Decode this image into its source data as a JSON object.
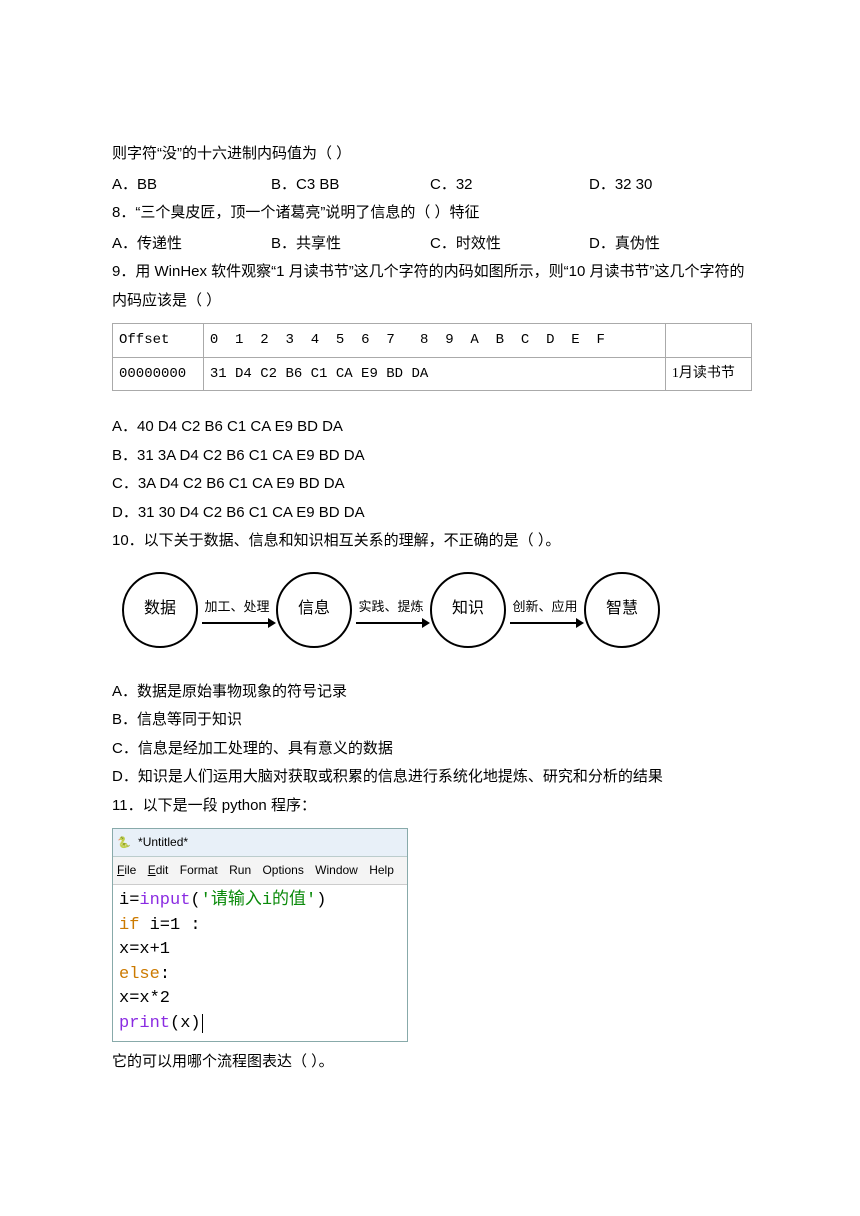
{
  "q7": {
    "stem": "则字符“没”的十六进制内码值为（    ）",
    "A": "A．BB",
    "B": "B．C3 BB",
    "C": "C．32",
    "D": "D．32 30"
  },
  "q8": {
    "stem": "8．“三个臭皮匠，顶一个诸葛亮”说明了信息的（    ）特征",
    "A": "A．传递性",
    "B": "B．共享性",
    "C": "C．时效性",
    "D": "D．真伪性"
  },
  "q9": {
    "stem": "9．用 WinHex 软件观察“1 月读书节”这几个字符的内码如图所示，则“10 月读书节”这几个字符的内码应该是（  ）",
    "table": {
      "headers": [
        "Offset",
        "0",
        "1",
        "2",
        "3",
        "4",
        "5",
        "6",
        "7",
        "",
        "8",
        "9",
        "A",
        "B",
        "C",
        "D",
        "E",
        "F",
        ""
      ],
      "row_addr": "00000000",
      "row_bytes": "31 D4 C2 B6 C1 CA E9 BD  DA",
      "row_text": "1月读书节"
    },
    "A": "A．40 D4 C2 B6 C1 CA E9 BD DA",
    "B": "B．31 3A D4 C2 B6 C1 CA E9 BD DA",
    "C": "C．3A D4 C2 B6 C1 CA E9 BD DA",
    "D": "D．31 30 D4 C2 B6 C1 CA E9 BD DA"
  },
  "q10": {
    "stem": "10．以下关于数据、信息和知识相互关系的理解，不正确的是（     ）。",
    "nodes": [
      "数据",
      "信息",
      "知识",
      "智慧"
    ],
    "arrows": [
      "加工、处理",
      "实践、提炼",
      "创新、应用"
    ],
    "A": "A．数据是原始事物现象的符号记录",
    "B": "B．信息等同于知识",
    "C": "C．信息是经加工处理的、具有意义的数据",
    "D": "D．知识是人们运用大脑对获取或积累的信息进行系统化地提炼、研究和分析的结果"
  },
  "q11": {
    "stem": "11．以下是一段 python 程序：",
    "ide_title": "*Untitled*",
    "menu": {
      "file": "File",
      "edit": "Edit",
      "format": "Format",
      "run": "Run",
      "options": "Options",
      "window": "Window",
      "help": "Help"
    },
    "code": {
      "l1a": "i=",
      "l1fn": "input",
      "l1p": "(",
      "l1s": "'请输入i的值'",
      "l1q": ")",
      "l2a": "if ",
      "l2b": "i=1 :",
      "l3": "    x=x+1",
      "l4": "else",
      "l4c": ":",
      "l5": "    x=x*2",
      "l6a": "print",
      "l6b": "(x)"
    },
    "tail": "它的可以用哪个流程图表达（     ）。"
  }
}
